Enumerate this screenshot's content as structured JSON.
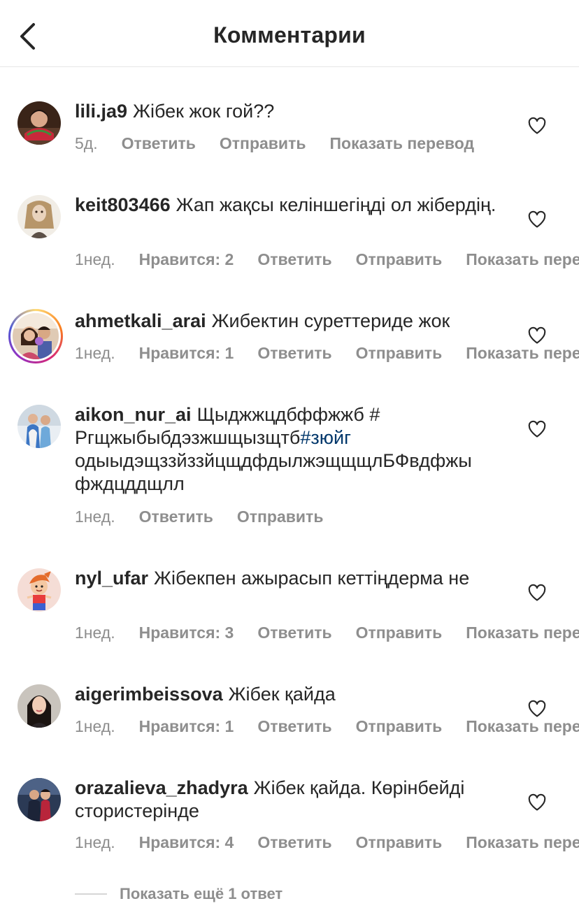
{
  "header": {
    "title": "Комментарии"
  },
  "comments": [
    {
      "username": "lili.ja9",
      "text": "Жібек жок гой??",
      "time": "5д.",
      "reply": "Ответить",
      "send": "Отправить",
      "translate": "Показать перевод"
    },
    {
      "username": "keit803466",
      "text": "Жап жақсы келіншегіңді ол жібердің.",
      "time": "1нед.",
      "likes": "Нравится: 2",
      "reply": "Ответить",
      "send": "Отправить",
      "translate": "Показать перевод"
    },
    {
      "username": "ahmetkali_arai",
      "text": "Жибектин суреттериде жок",
      "time": "1нед.",
      "likes": "Нравится: 1",
      "reply": "Ответить",
      "send": "Отправить",
      "translate": "Показать перевод"
    },
    {
      "username": "aikon_nur_ai",
      "text_before": "Щыджжцдбффжжб # Ргщжыбыбдэзжшщызщтб",
      "hashtag": "#зюйг",
      "text_after": "одыыдэщззйззйцщдфдылжэщщщлБФвдфжы фждцддщлл",
      "time": "1нед.",
      "reply": "Ответить",
      "send": "Отправить"
    },
    {
      "username": "nyl_ufar",
      "text": "Жібекпен ажырасып кеттіңдерма не",
      "time": "1нед.",
      "likes": "Нравится: 3",
      "reply": "Ответить",
      "send": "Отправить",
      "translate": "Показать перевод"
    },
    {
      "username": "aigerimbeissova",
      "text": "Жібек қайда",
      "time": "1нед.",
      "likes": "Нравится: 1",
      "reply": "Ответить",
      "send": "Отправить",
      "translate": "Показать перевод"
    },
    {
      "username": "orazalieva_zhadyra",
      "text": "Жібек қайда. Көрінбейді стористерінде",
      "time": "1нед.",
      "likes": "Нравится: 4",
      "reply": "Ответить",
      "send": "Отправить",
      "translate": "Показать перевод"
    }
  ],
  "show_more_replies": "Показать ещё 1 ответ",
  "icons": {
    "back": "chevron-left-icon",
    "like": "heart-outline-icon"
  },
  "colors": {
    "text": "#262626",
    "meta": "#8e8e8e",
    "hashtag": "#00376b",
    "divider": "#e6e6e6"
  }
}
